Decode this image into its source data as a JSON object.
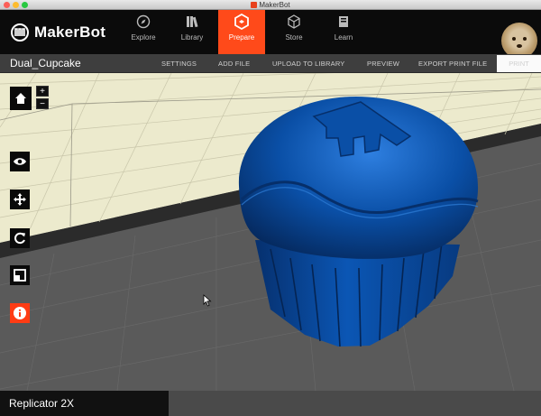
{
  "window": {
    "title": "MakerBot"
  },
  "brand": {
    "name": "MakerBot"
  },
  "nav": [
    {
      "label": "Explore",
      "icon": "compass-icon"
    },
    {
      "label": "Library",
      "icon": "library-icon"
    },
    {
      "label": "Prepare",
      "icon": "prepare-icon",
      "active": true
    },
    {
      "label": "Store",
      "icon": "store-icon"
    },
    {
      "label": "Learn",
      "icon": "learn-icon"
    }
  ],
  "project": {
    "name": "Dual_Cupcake"
  },
  "actions": {
    "settings": "SETTINGS",
    "add_file": "ADD FILE",
    "upload": "UPLOAD TO LIBRARY",
    "preview": "PREVIEW",
    "export": "EXPORT PRINT FILE",
    "print": "PRINT"
  },
  "zoom": {
    "plus": "+",
    "minus": "−"
  },
  "tools": [
    "home-icon",
    "eye-icon",
    "move-icon",
    "rotate-icon",
    "scale-icon",
    "info-icon"
  ],
  "colors": {
    "accent": "#ff4a1a",
    "model": "#0a4fa6",
    "plate": "#eceacd"
  },
  "footer": {
    "machine": "Replicator 2X"
  }
}
